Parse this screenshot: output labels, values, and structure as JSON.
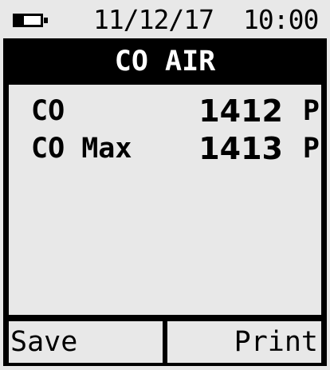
{
  "status": {
    "battery_level": 0.35,
    "date": "11/12/17",
    "time": "10:00"
  },
  "screen": {
    "title": "CO AIR"
  },
  "readings": [
    {
      "label": "CO",
      "value": "1412",
      "unit": "P"
    },
    {
      "label": "CO Max",
      "value": "1413",
      "unit": "P"
    }
  ],
  "softkeys": {
    "left": "Save",
    "right": "Print"
  },
  "colors": {
    "background": "#e8e8e8",
    "frame": "#000000",
    "title_text": "#ffffff"
  }
}
